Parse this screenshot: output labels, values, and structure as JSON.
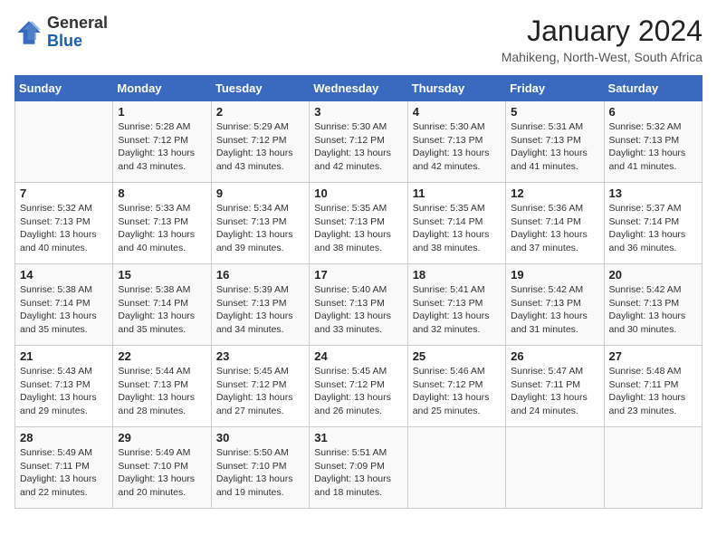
{
  "header": {
    "logo_line1": "General",
    "logo_line2": "Blue",
    "title": "January 2024",
    "subtitle": "Mahikeng, North-West, South Africa"
  },
  "days_of_week": [
    "Sunday",
    "Monday",
    "Tuesday",
    "Wednesday",
    "Thursday",
    "Friday",
    "Saturday"
  ],
  "weeks": [
    [
      {
        "day": "",
        "info": ""
      },
      {
        "day": "1",
        "info": "Sunrise: 5:28 AM\nSunset: 7:12 PM\nDaylight: 13 hours\nand 43 minutes."
      },
      {
        "day": "2",
        "info": "Sunrise: 5:29 AM\nSunset: 7:12 PM\nDaylight: 13 hours\nand 43 minutes."
      },
      {
        "day": "3",
        "info": "Sunrise: 5:30 AM\nSunset: 7:12 PM\nDaylight: 13 hours\nand 42 minutes."
      },
      {
        "day": "4",
        "info": "Sunrise: 5:30 AM\nSunset: 7:13 PM\nDaylight: 13 hours\nand 42 minutes."
      },
      {
        "day": "5",
        "info": "Sunrise: 5:31 AM\nSunset: 7:13 PM\nDaylight: 13 hours\nand 41 minutes."
      },
      {
        "day": "6",
        "info": "Sunrise: 5:32 AM\nSunset: 7:13 PM\nDaylight: 13 hours\nand 41 minutes."
      }
    ],
    [
      {
        "day": "7",
        "info": "Sunrise: 5:32 AM\nSunset: 7:13 PM\nDaylight: 13 hours\nand 40 minutes."
      },
      {
        "day": "8",
        "info": "Sunrise: 5:33 AM\nSunset: 7:13 PM\nDaylight: 13 hours\nand 40 minutes."
      },
      {
        "day": "9",
        "info": "Sunrise: 5:34 AM\nSunset: 7:13 PM\nDaylight: 13 hours\nand 39 minutes."
      },
      {
        "day": "10",
        "info": "Sunrise: 5:35 AM\nSunset: 7:13 PM\nDaylight: 13 hours\nand 38 minutes."
      },
      {
        "day": "11",
        "info": "Sunrise: 5:35 AM\nSunset: 7:14 PM\nDaylight: 13 hours\nand 38 minutes."
      },
      {
        "day": "12",
        "info": "Sunrise: 5:36 AM\nSunset: 7:14 PM\nDaylight: 13 hours\nand 37 minutes."
      },
      {
        "day": "13",
        "info": "Sunrise: 5:37 AM\nSunset: 7:14 PM\nDaylight: 13 hours\nand 36 minutes."
      }
    ],
    [
      {
        "day": "14",
        "info": "Sunrise: 5:38 AM\nSunset: 7:14 PM\nDaylight: 13 hours\nand 35 minutes."
      },
      {
        "day": "15",
        "info": "Sunrise: 5:38 AM\nSunset: 7:14 PM\nDaylight: 13 hours\nand 35 minutes."
      },
      {
        "day": "16",
        "info": "Sunrise: 5:39 AM\nSunset: 7:13 PM\nDaylight: 13 hours\nand 34 minutes."
      },
      {
        "day": "17",
        "info": "Sunrise: 5:40 AM\nSunset: 7:13 PM\nDaylight: 13 hours\nand 33 minutes."
      },
      {
        "day": "18",
        "info": "Sunrise: 5:41 AM\nSunset: 7:13 PM\nDaylight: 13 hours\nand 32 minutes."
      },
      {
        "day": "19",
        "info": "Sunrise: 5:42 AM\nSunset: 7:13 PM\nDaylight: 13 hours\nand 31 minutes."
      },
      {
        "day": "20",
        "info": "Sunrise: 5:42 AM\nSunset: 7:13 PM\nDaylight: 13 hours\nand 30 minutes."
      }
    ],
    [
      {
        "day": "21",
        "info": "Sunrise: 5:43 AM\nSunset: 7:13 PM\nDaylight: 13 hours\nand 29 minutes."
      },
      {
        "day": "22",
        "info": "Sunrise: 5:44 AM\nSunset: 7:13 PM\nDaylight: 13 hours\nand 28 minutes."
      },
      {
        "day": "23",
        "info": "Sunrise: 5:45 AM\nSunset: 7:12 PM\nDaylight: 13 hours\nand 27 minutes."
      },
      {
        "day": "24",
        "info": "Sunrise: 5:45 AM\nSunset: 7:12 PM\nDaylight: 13 hours\nand 26 minutes."
      },
      {
        "day": "25",
        "info": "Sunrise: 5:46 AM\nSunset: 7:12 PM\nDaylight: 13 hours\nand 25 minutes."
      },
      {
        "day": "26",
        "info": "Sunrise: 5:47 AM\nSunset: 7:11 PM\nDaylight: 13 hours\nand 24 minutes."
      },
      {
        "day": "27",
        "info": "Sunrise: 5:48 AM\nSunset: 7:11 PM\nDaylight: 13 hours\nand 23 minutes."
      }
    ],
    [
      {
        "day": "28",
        "info": "Sunrise: 5:49 AM\nSunset: 7:11 PM\nDaylight: 13 hours\nand 22 minutes."
      },
      {
        "day": "29",
        "info": "Sunrise: 5:49 AM\nSunset: 7:10 PM\nDaylight: 13 hours\nand 20 minutes."
      },
      {
        "day": "30",
        "info": "Sunrise: 5:50 AM\nSunset: 7:10 PM\nDaylight: 13 hours\nand 19 minutes."
      },
      {
        "day": "31",
        "info": "Sunrise: 5:51 AM\nSunset: 7:09 PM\nDaylight: 13 hours\nand 18 minutes."
      },
      {
        "day": "",
        "info": ""
      },
      {
        "day": "",
        "info": ""
      },
      {
        "day": "",
        "info": ""
      }
    ]
  ]
}
